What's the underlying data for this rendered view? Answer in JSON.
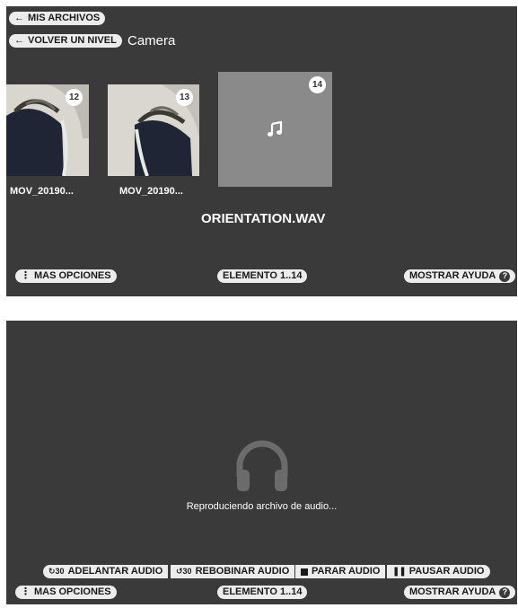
{
  "nav": {
    "my_files_label": "MIS ARCHIVOS",
    "back_level_label": "VOLVER UN NIVEL",
    "folder_title": "Camera"
  },
  "files": [
    {
      "number": "12",
      "name": "MOV_20190...",
      "kind": "video"
    },
    {
      "number": "13",
      "name": "MOV_20190...",
      "kind": "video"
    },
    {
      "number": "14",
      "name": "ORIENTATION.WAV",
      "kind": "audio",
      "selected": true
    }
  ],
  "footer": {
    "more_options_label": "MAS OPCIONES",
    "element_range_label": "ELEMENTO 1..14",
    "show_help_label": "MOSTRAR AYUDA",
    "help_glyph": "?"
  },
  "player": {
    "status_text": "Reproduciendo archivo de audio...",
    "forward_label": "ADELANTAR AUDIO",
    "forward_glyph": "30",
    "rewind_label": "REBOBINAR AUDIO",
    "rewind_glyph": "30",
    "stop_label": "PARAR AUDIO",
    "pause_label": "PAUSAR AUDIO"
  },
  "colors": {
    "panel_bg": "#3a3a3a",
    "pill_bg": "#ececec",
    "audio_tile_bg": "#8a8a8a",
    "headphones": "#6b6b6b"
  }
}
